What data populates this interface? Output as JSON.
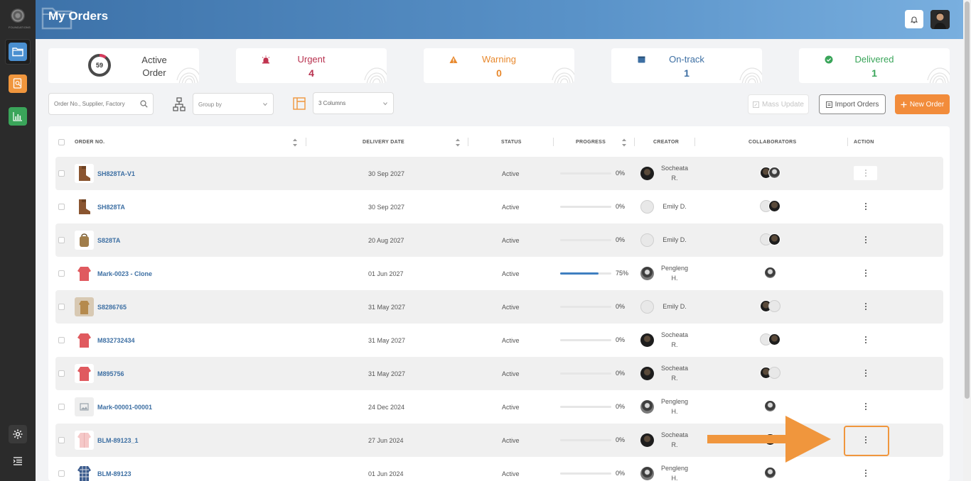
{
  "header": {
    "title": "My Orders"
  },
  "logo": {
    "word": "FOUNDATIONS"
  },
  "sidebar": {
    "items": [
      {
        "name": "orders",
        "icon": "folder-icon"
      },
      {
        "name": "reports",
        "icon": "search-document-icon"
      },
      {
        "name": "analytics",
        "icon": "bar-chart-icon"
      }
    ]
  },
  "summary": {
    "active": {
      "count": "59",
      "label_line1": "Active",
      "label_line2": "Order"
    },
    "urgent": {
      "label": "Urgent",
      "count": "4",
      "color": "#b8324f"
    },
    "warning": {
      "label": "Warning",
      "count": "0",
      "color": "#e8892e"
    },
    "ontrack": {
      "label": "On-track",
      "count": "1",
      "color": "#3d6fa3"
    },
    "delivered": {
      "label": "Delivered",
      "count": "1",
      "color": "#3aa55a"
    }
  },
  "toolbar": {
    "search_placeholder": "Order No., Supplier, Factory",
    "group_by_placeholder": "Group by",
    "columns_value": "3 Columns",
    "mass_update": "Mass Update",
    "import_orders": "Import Orders",
    "new_order": "New Order"
  },
  "table": {
    "headers": {
      "order_no": "ORDER NO.",
      "delivery_date": "DELIVERY DATE",
      "status": "STATUS",
      "progress": "PROGRESS",
      "creator": "CREATOR",
      "collaborators": "COLLABORATORS",
      "action": "ACTION"
    },
    "rows": [
      {
        "order_no": "SH828TA-V1",
        "delivery": "30 Sep 2027",
        "status": "Active",
        "progress": "0%",
        "progress_value": 0,
        "creator_line1": "Socheata",
        "creator_line2": "R.",
        "thumb": "boot"
      },
      {
        "order_no": "SH828TA",
        "delivery": "30 Sep 2027",
        "status": "Active",
        "progress": "0%",
        "progress_value": 0,
        "creator_line1": "Emily D.",
        "creator_line2": "",
        "thumb": "boot"
      },
      {
        "order_no": "S828TA",
        "delivery": "20 Aug 2027",
        "status": "Active",
        "progress": "0%",
        "progress_value": 0,
        "creator_line1": "Emily D.",
        "creator_line2": "",
        "thumb": "bag"
      },
      {
        "order_no": "Mark-0023 - Clone",
        "delivery": "01 Jun 2027",
        "status": "Active",
        "progress": "75%",
        "progress_value": 75,
        "creator_line1": "Pengleng",
        "creator_line2": "H.",
        "thumb": "jacket"
      },
      {
        "order_no": "S8286765",
        "delivery": "31 May 2027",
        "status": "Active",
        "progress": "0%",
        "progress_value": 0,
        "creator_line1": "Emily D.",
        "creator_line2": "",
        "thumb": "coat"
      },
      {
        "order_no": "M832732434",
        "delivery": "31 May 2027",
        "status": "Active",
        "progress": "0%",
        "progress_value": 0,
        "creator_line1": "Socheata",
        "creator_line2": "R.",
        "thumb": "jacket"
      },
      {
        "order_no": "M895756",
        "delivery": "31 May 2027",
        "status": "Active",
        "progress": "0%",
        "progress_value": 0,
        "creator_line1": "Socheata",
        "creator_line2": "R.",
        "thumb": "jacket"
      },
      {
        "order_no": "Mark-00001-00001",
        "delivery": "24 Dec 2024",
        "status": "Active",
        "progress": "0%",
        "progress_value": 0,
        "creator_line1": "Pengleng",
        "creator_line2": "H.",
        "thumb": "placeholder"
      },
      {
        "order_no": "BLM-89123_1",
        "delivery": "27 Jun 2024",
        "status": "Active",
        "progress": "0%",
        "progress_value": 0,
        "creator_line1": "Socheata",
        "creator_line2": "R.",
        "thumb": "pink"
      },
      {
        "order_no": "BLM-89123",
        "delivery": "01 Jun 2024",
        "status": "Active",
        "progress": "0%",
        "progress_value": 0,
        "creator_line1": "Pengleng",
        "creator_line2": "H.",
        "thumb": "plaid"
      }
    ]
  }
}
